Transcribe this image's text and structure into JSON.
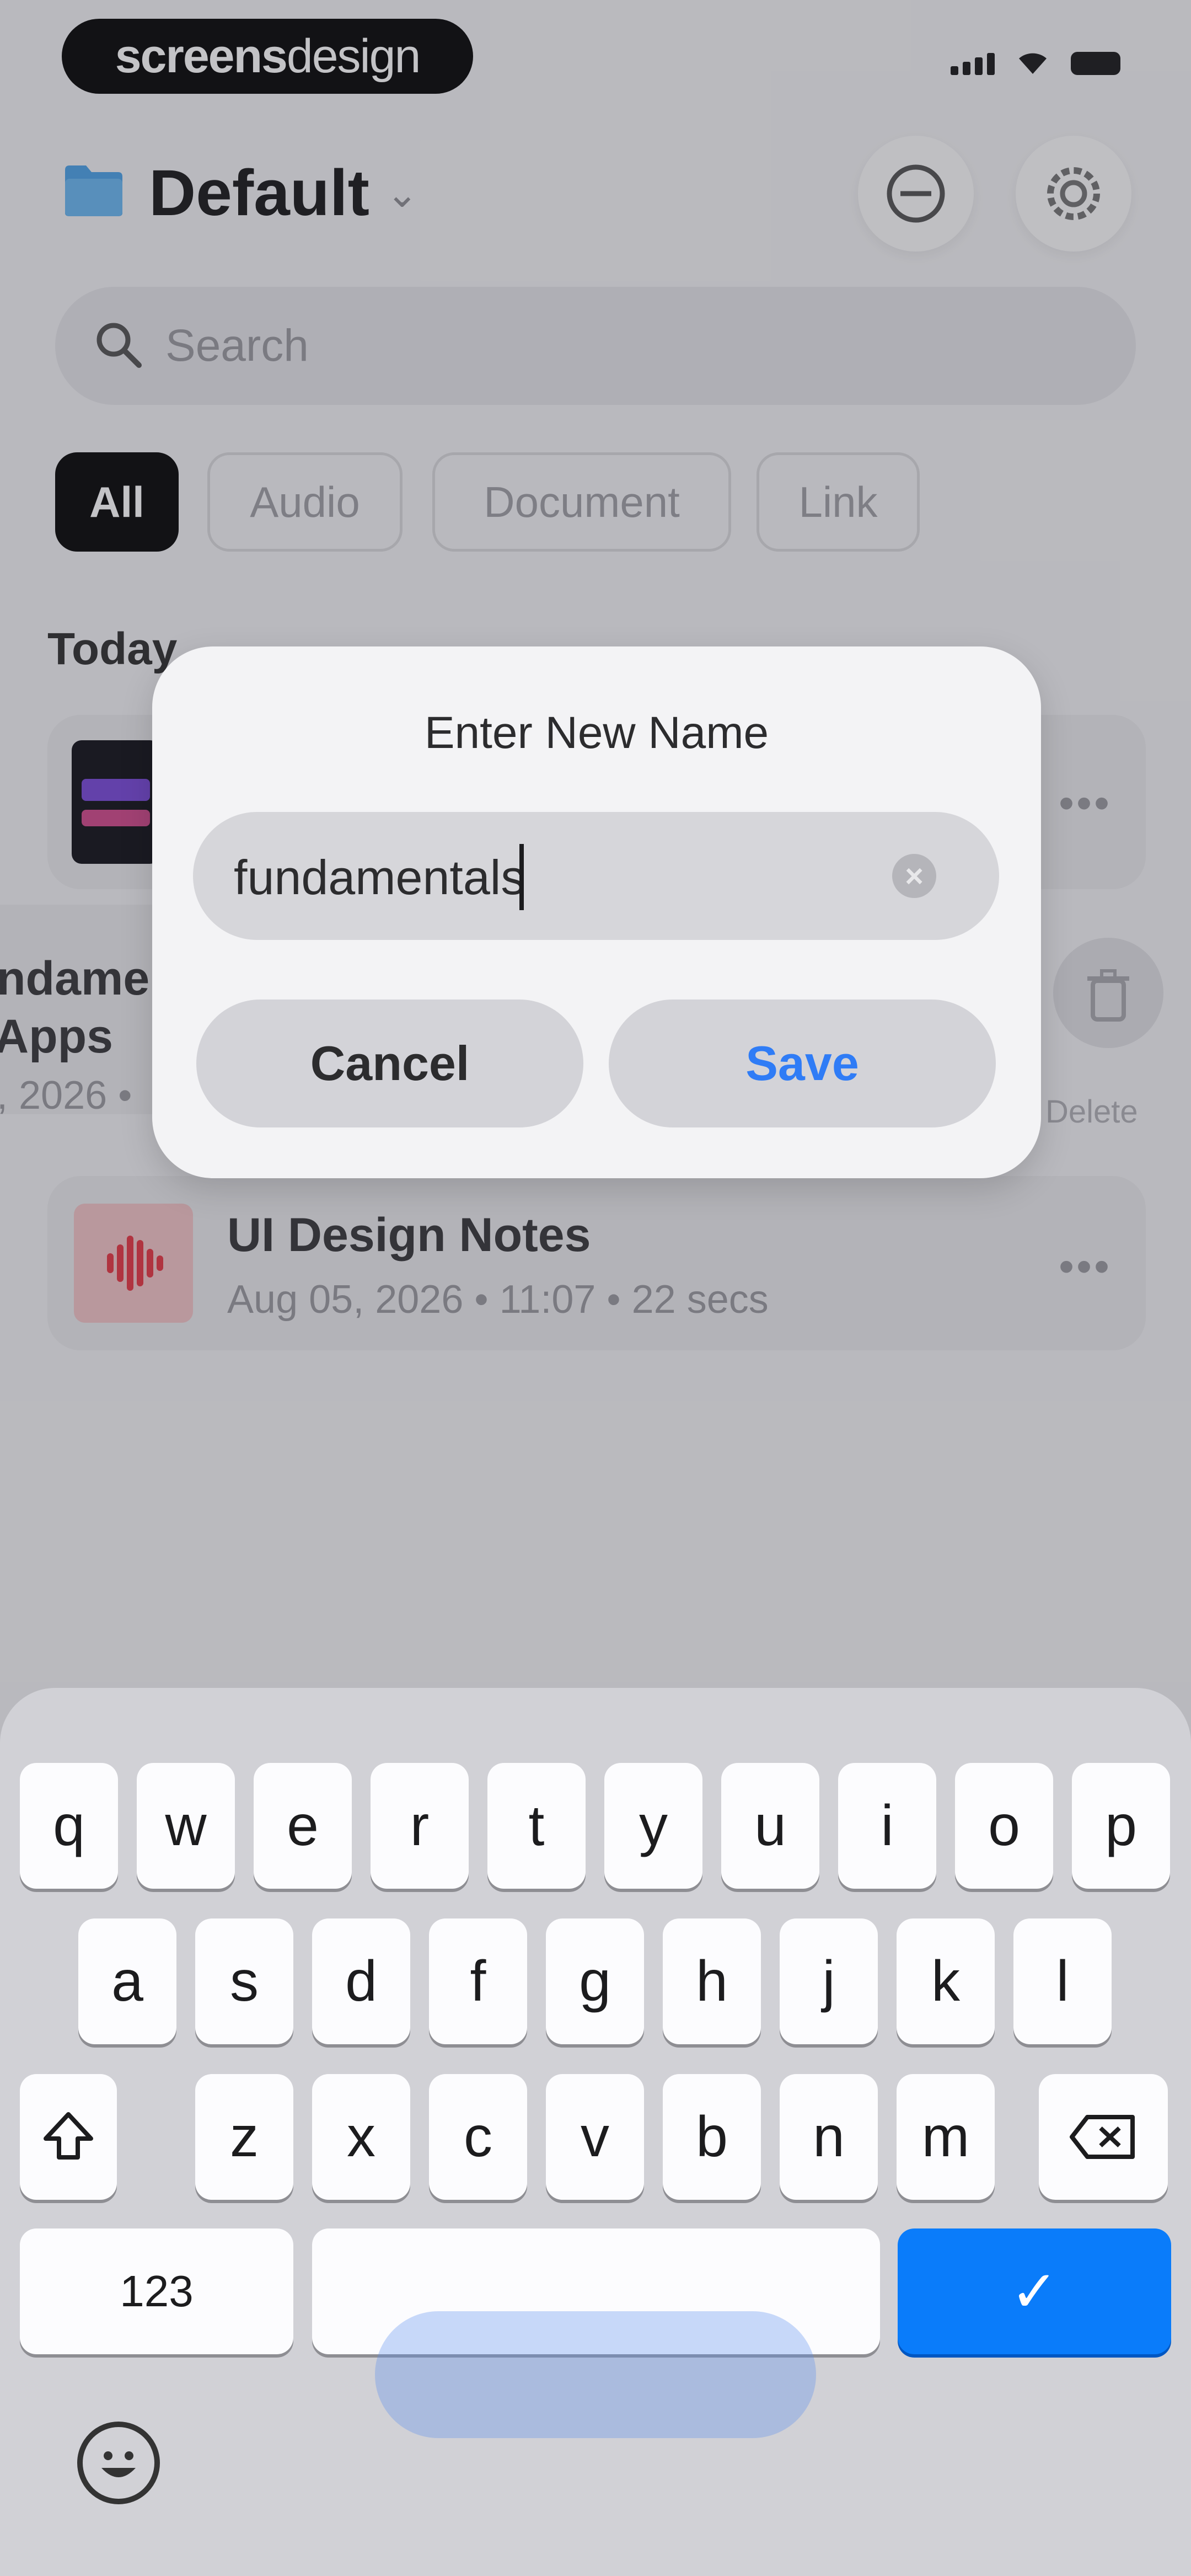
{
  "watermark": {
    "part1": "screens",
    "part2": "design"
  },
  "header": {
    "title": "Default"
  },
  "search": {
    "placeholder": "Search"
  },
  "filters": [
    {
      "label": "All",
      "active": true
    },
    {
      "label": "Audio",
      "active": false
    },
    {
      "label": "Document",
      "active": false
    },
    {
      "label": "Link",
      "active": false
    }
  ],
  "section_label": "Today",
  "items": [
    {
      "title": "UI Design Notes",
      "subtitle": "Aug 05, 2026 • 11:07 • 22 secs",
      "more": "•••"
    }
  ],
  "swiped_row": {
    "title_fragment": "ndame",
    "title_fragment2": "Apps",
    "subtitle_fragment": ", 2026 •",
    "delete_label": "Delete"
  },
  "dialog": {
    "title": "Enter New Name",
    "input_value": "fundamentals",
    "cancel_label": "Cancel",
    "save_label": "Save"
  },
  "keyboard": {
    "row1": [
      "q",
      "w",
      "e",
      "r",
      "t",
      "y",
      "u",
      "i",
      "o",
      "p"
    ],
    "row2": [
      "a",
      "s",
      "d",
      "f",
      "g",
      "h",
      "j",
      "k",
      "l"
    ],
    "row3": [
      "z",
      "x",
      "c",
      "v",
      "b",
      "n",
      "m"
    ],
    "numbers_label": "123",
    "return_label": "✓"
  },
  "colors": {
    "accent": "#0a7cfa",
    "save_text": "#2f7cf6",
    "brand_dark": "#0b0b0b"
  }
}
